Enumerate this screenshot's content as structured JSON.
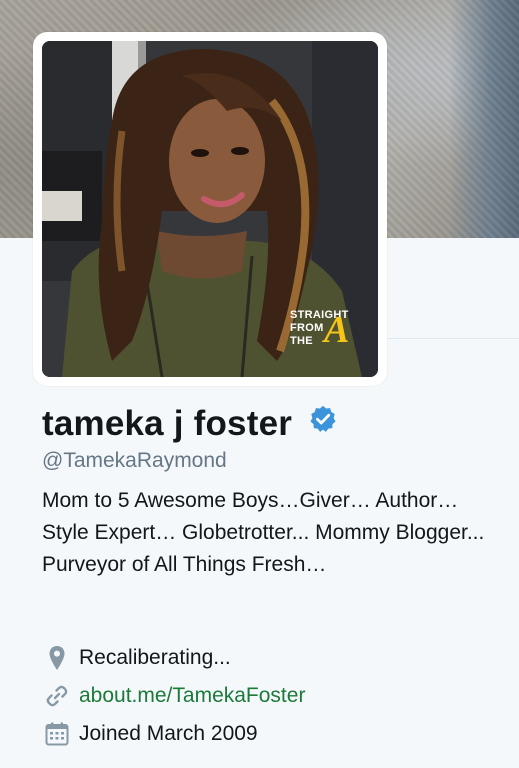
{
  "profile": {
    "display_name": "tameka j foster",
    "handle": "@TamekaRaymond",
    "verified": true,
    "bio": "Mom to 5 Awesome Boys…Giver… Author… Style Expert… Globetrotter... Mommy Blogger... Purveyor of All Things Fresh…",
    "location": "Recaliberating...",
    "website": "about.me/TamekaFoster",
    "joined": "Joined March 2009"
  },
  "watermark": {
    "line1": "STRAIGHT",
    "line2": "FROM",
    "line3": "THE",
    "letter": "A"
  },
  "icons": {
    "verified": "verified-badge-icon",
    "location": "location-pin-icon",
    "website": "link-icon",
    "joined": "calendar-icon"
  },
  "colors": {
    "verified_blue": "#3b94d9",
    "link_green": "#1b7a3a",
    "secondary_text": "#657786",
    "icon_gray": "#8899a6"
  }
}
